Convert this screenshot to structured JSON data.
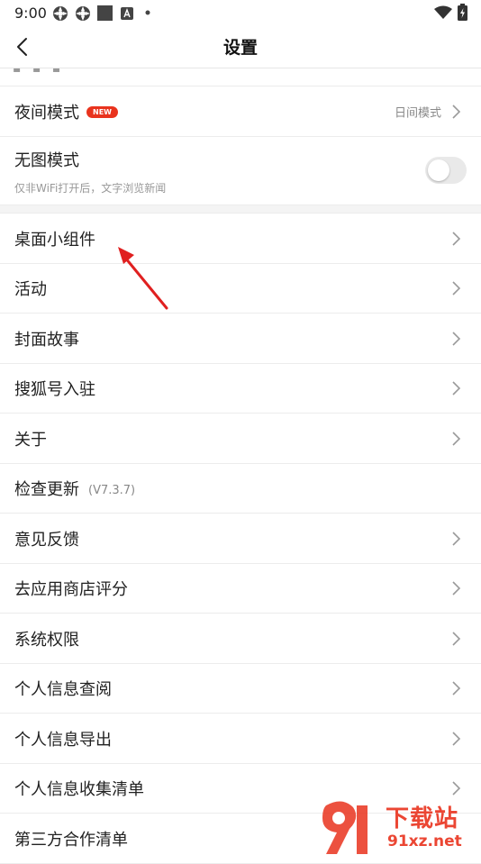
{
  "status_bar": {
    "time": "9:00",
    "icons": [
      "gear-notification-icon",
      "gear-notification-icon",
      "square-notification-icon",
      "a-notification-icon",
      "dot-icon",
      "wifi-icon",
      "battery-icon"
    ]
  },
  "navbar": {
    "title": "设置",
    "back_icon": "chevron-left-icon"
  },
  "colors": {
    "badge": "#e9331d",
    "annotation_arrow": "#e02020",
    "watermark": "#e9331d"
  },
  "rows": {
    "night_mode": {
      "label": "夜间模式",
      "badge": "NEW",
      "value": "日间模式"
    },
    "no_image_mode": {
      "label": "无图模式",
      "subtitle": "仅非WiFi打开后，文字浏览新闻",
      "toggle_on": false
    },
    "desktop_widget": {
      "label": "桌面小组件"
    },
    "activity": {
      "label": "活动"
    },
    "cover_story": {
      "label": "封面故事"
    },
    "sohu_account": {
      "label": "搜狐号入驻"
    },
    "about": {
      "label": "关于"
    },
    "check_update": {
      "label": "检查更新",
      "version": "(V7.3.7)"
    },
    "feedback": {
      "label": "意见反馈"
    },
    "rate_app": {
      "label": "去应用商店评分"
    },
    "system_permissions": {
      "label": "系统权限"
    },
    "personal_info_view": {
      "label": "个人信息查阅"
    },
    "personal_info_export": {
      "label": "个人信息导出"
    },
    "personal_info_collection": {
      "label": "个人信息收集清单"
    },
    "third_party": {
      "label": "第三方合作清单"
    }
  },
  "watermark": {
    "text_top": "下载站",
    "text_bottom": "91xz.net"
  }
}
